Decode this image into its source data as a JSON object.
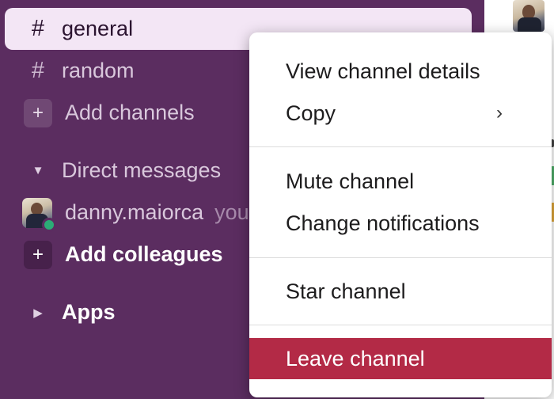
{
  "sidebar": {
    "channels": [
      {
        "name": "general",
        "prefix": "#",
        "selected": true
      },
      {
        "name": "random",
        "prefix": "#",
        "selected": false
      }
    ],
    "add_channels_label": "Add channels",
    "add_icon": "+",
    "dm_section": {
      "caret": "▼",
      "label": "Direct messages"
    },
    "dm_user": {
      "name": "danny.maiorca",
      "suffix": "you"
    },
    "add_colleagues_label": "Add colleagues",
    "apps_section": {
      "caret": "▶",
      "label": "Apps"
    }
  },
  "context_menu": {
    "items": [
      {
        "label": "View channel details",
        "submenu": false
      },
      {
        "label": "Copy",
        "submenu": true,
        "submenu_icon": "›"
      },
      {
        "label": "Mute channel",
        "submenu": false
      },
      {
        "label": "Change notifications",
        "submenu": false
      },
      {
        "label": "Star channel",
        "submenu": false
      },
      {
        "label": "Leave channel",
        "submenu": false,
        "danger": true
      }
    ]
  },
  "colors": {
    "sidebar_bg": "#5b2d60",
    "selected_bg": "#f3e6f5",
    "danger": "#b32a46",
    "presence_online": "#2bac76"
  }
}
